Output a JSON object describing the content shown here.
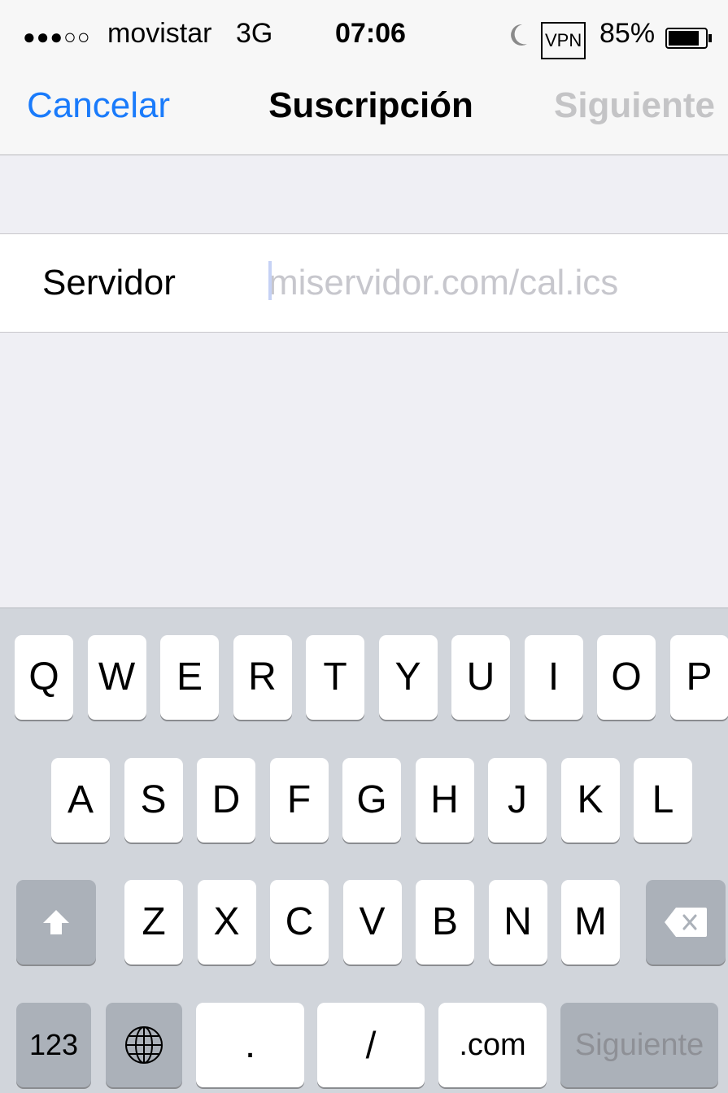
{
  "status_bar": {
    "signal": "●●●○○",
    "carrier": "movistar",
    "network": "3G",
    "time": "07:06",
    "moon_icon": "do-not-disturb-moon-icon",
    "vpn": "VPN",
    "battery_percent": "85%",
    "battery_icon": "battery-icon",
    "battery_level": 0.85
  },
  "nav": {
    "cancel": "Cancelar",
    "title": "Suscripción",
    "next": "Siguiente"
  },
  "form": {
    "server_label": "Servidor",
    "server_value": "",
    "server_placeholder": "miservidor.com/cal.ics"
  },
  "keyboard": {
    "row1": [
      "Q",
      "W",
      "E",
      "R",
      "T",
      "Y",
      "U",
      "I",
      "O",
      "P"
    ],
    "row2": [
      "A",
      "S",
      "D",
      "F",
      "G",
      "H",
      "J",
      "K",
      "L"
    ],
    "row3": [
      "Z",
      "X",
      "C",
      "V",
      "B",
      "N",
      "M"
    ],
    "shift_icon": "shift-arrow-icon",
    "delete_icon": "backspace-icon",
    "numbers": "123",
    "globe_icon": "globe-icon",
    "dot": ".",
    "slash": "/",
    "dotcom": ".com",
    "return": "Siguiente"
  },
  "colors": {
    "accent": "#1a7bfb",
    "disabled": "#c4c4c6",
    "keyboard_bg": "#d1d5db",
    "dark_key": "#abb1b9"
  }
}
